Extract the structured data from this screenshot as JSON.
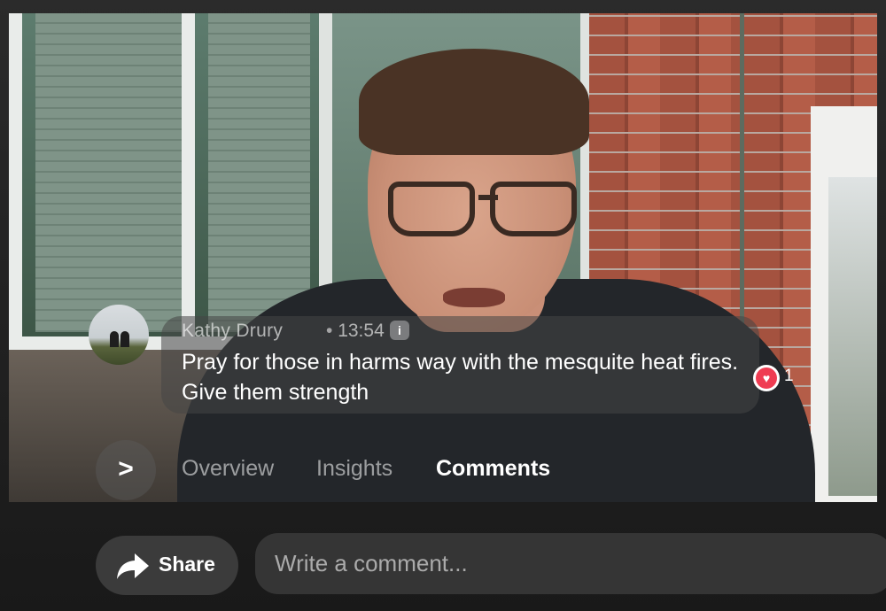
{
  "comment": {
    "author": "Kathy Drury",
    "separator": "•",
    "time": "13:54",
    "badge": "i",
    "text": "Pray for those in harms way with the mesquite heat fires. Give them strength",
    "reaction_icon": "heart-icon",
    "reaction_count": "1"
  },
  "tabs": [
    {
      "label": "Overview",
      "active": false
    },
    {
      "label": "Insights",
      "active": false
    },
    {
      "label": "Comments",
      "active": true
    }
  ],
  "toggle": {
    "icon": "chevron-right-icon",
    "glyph": ">"
  },
  "footer": {
    "share_label": "Share",
    "share_icon": "share-arrow-icon",
    "comment_placeholder": "Write a comment..."
  },
  "colors": {
    "reaction": "#ef3c52",
    "panel": "#353535"
  }
}
